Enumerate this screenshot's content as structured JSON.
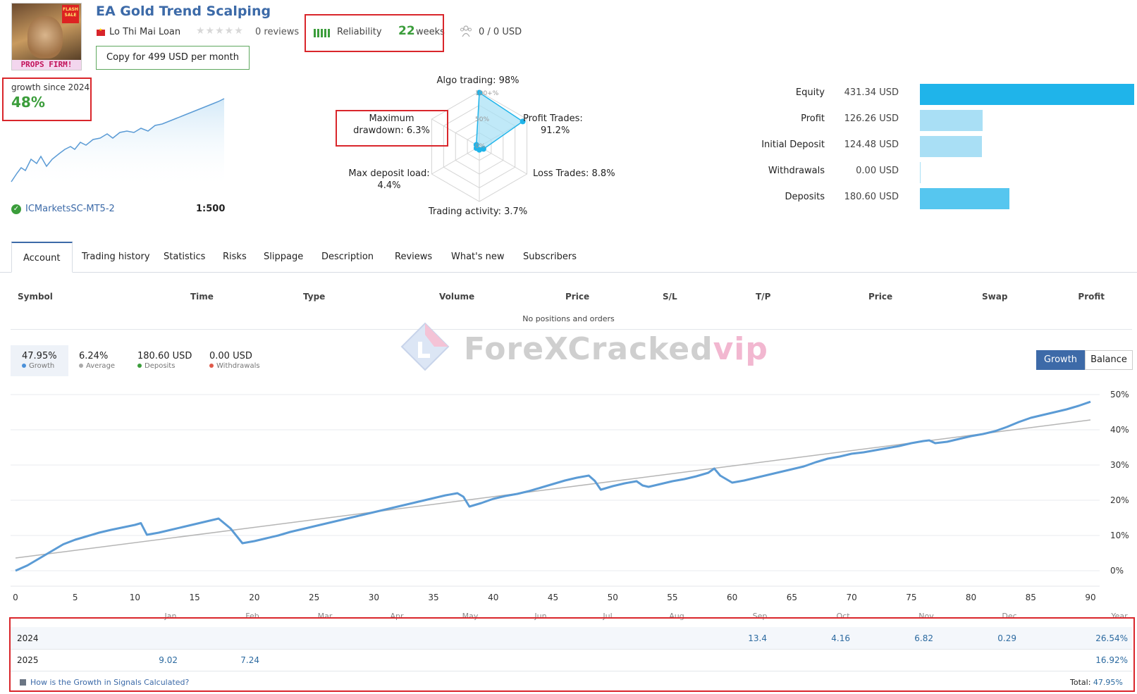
{
  "header": {
    "title": "EA Gold Trend Scalping",
    "author": "Lo Thi Mai Loan",
    "reviews": "0 reviews",
    "reliability_label": "Reliability",
    "weeks_number": "22",
    "weeks_label": "weeks",
    "subscribers": "0 / 0 USD",
    "copy_button": "Copy for 499 USD per month",
    "avatar_banner": "PROPS FIRM!",
    "avatar_badge": "FLASH SALE"
  },
  "growth_card": {
    "label": "growth since 2024",
    "value": "48%",
    "broker": "ICMarketsSC-MT5-2",
    "leverage": "1:500"
  },
  "radar": {
    "algo": "Algo trading: 98%",
    "profit_trades_1": "Profit Trades:",
    "profit_trades_2": "91.2%",
    "loss_trades": "Loss Trades: 8.8%",
    "activity": "Trading activity: 3.7%",
    "deposit_load_1": "Max deposit load:",
    "deposit_load_2": "4.4%",
    "drawdown_1": "Maximum",
    "drawdown_2": "drawdown: 6.3%",
    "ring_100": "100+%",
    "ring_50": "50%",
    "ring_0": "0%",
    "values": {
      "algo": 98,
      "profit": 91.2,
      "loss": 8.8,
      "activity": 3.7,
      "deposit_load": 4.4,
      "drawdown": 6.3
    }
  },
  "stats": [
    {
      "label": "Equity",
      "value": "431.34 USD",
      "fraction": 1.0,
      "color": "#1fb4ea"
    },
    {
      "label": "Profit",
      "value": "126.26 USD",
      "fraction": 0.293,
      "color": "#a9dff5"
    },
    {
      "label": "Initial Deposit",
      "value": "124.48 USD",
      "fraction": 0.289,
      "color": "#a9dff5"
    },
    {
      "label": "Withdrawals",
      "value": "0.00 USD",
      "fraction": 0.0,
      "color": "#a9dff5"
    },
    {
      "label": "Deposits",
      "value": "180.60 USD",
      "fraction": 0.419,
      "color": "#56c6ef"
    }
  ],
  "tabs": [
    "Account",
    "Trading history",
    "Statistics",
    "Risks",
    "Slippage",
    "Description",
    "Reviews",
    "What's new",
    "Subscribers"
  ],
  "positions": {
    "columns": [
      "Symbol",
      "Time",
      "Type",
      "Volume",
      "Price",
      "S/L",
      "T/P",
      "Price",
      "Swap",
      "Profit"
    ],
    "empty_text": "No positions and orders"
  },
  "summary": {
    "growth": {
      "value": "47.95%",
      "caption": "Growth",
      "color": "#4a90d9"
    },
    "average": {
      "value": "6.24%",
      "caption": "Average",
      "color": "#aaaaaa"
    },
    "deposits": {
      "value": "180.60 USD",
      "caption": "Deposits",
      "color": "#3b9d3b"
    },
    "withdrawals": {
      "value": "0.00 USD",
      "caption": "Withdrawals",
      "color": "#e05a4a"
    },
    "btn_growth": "Growth",
    "btn_balance": "Balance"
  },
  "watermark": {
    "main": "ForeXCracked",
    "suffix": "vip"
  },
  "chart_data": {
    "type": "line",
    "xlim": [
      0,
      90
    ],
    "ylim": [
      0,
      50
    ],
    "x_ticks": [
      0,
      5,
      10,
      15,
      20,
      25,
      30,
      35,
      40,
      45,
      50,
      55,
      60,
      65,
      70,
      75,
      80,
      85,
      90
    ],
    "y_ticks": [
      "50%",
      "40%",
      "30%",
      "20%",
      "10%",
      "0%"
    ],
    "y_tick_values": [
      50,
      40,
      30,
      20,
      10,
      0
    ],
    "grid": true,
    "series": [
      {
        "name": "Growth",
        "color": "#5b9bd5",
        "x": [
          0,
          1,
          2,
          3,
          4,
          5,
          6,
          7,
          8,
          9,
          10,
          10.5,
          11,
          12,
          13,
          14,
          15,
          16,
          17,
          18,
          19,
          20,
          21,
          22,
          23,
          24,
          25,
          26,
          27,
          28,
          29,
          30,
          31,
          32,
          33,
          34,
          35,
          36,
          37,
          37.5,
          38,
          39,
          40,
          41,
          42,
          43,
          44,
          45,
          46,
          47,
          48,
          48.5,
          49,
          50,
          51,
          52,
          52.5,
          53,
          54,
          55,
          56,
          57,
          58,
          58.5,
          59,
          60,
          61,
          62,
          63,
          64,
          65,
          66,
          67,
          68,
          69,
          70,
          71,
          72,
          73,
          74,
          75,
          76,
          76.5,
          77,
          78,
          79,
          80,
          81,
          82,
          83,
          84,
          85,
          86,
          87,
          88,
          89,
          90
        ],
        "y": [
          0,
          1.5,
          3.5,
          5.5,
          7.5,
          8.8,
          9.8,
          10.8,
          11.6,
          12.3,
          13.0,
          13.5,
          10.2,
          10.8,
          11.6,
          12.4,
          13.2,
          14.0,
          14.8,
          12.0,
          7.8,
          8.4,
          9.2,
          10.0,
          11.0,
          11.8,
          12.6,
          13.4,
          14.2,
          15.0,
          15.8,
          16.6,
          17.4,
          18.2,
          19.0,
          19.8,
          20.6,
          21.4,
          22.0,
          21.0,
          18.2,
          19.2,
          20.4,
          21.2,
          21.8,
          22.6,
          23.6,
          24.6,
          25.6,
          26.4,
          27.0,
          25.5,
          23.0,
          24.0,
          24.8,
          25.4,
          24.2,
          23.8,
          24.6,
          25.4,
          26.0,
          26.8,
          27.8,
          29.0,
          27.0,
          25.0,
          25.6,
          26.4,
          27.2,
          28.0,
          28.8,
          29.6,
          30.8,
          31.8,
          32.4,
          33.2,
          33.6,
          34.2,
          34.8,
          35.4,
          36.2,
          36.8,
          37.0,
          36.2,
          36.6,
          37.4,
          38.2,
          38.8,
          39.6,
          40.8,
          42.2,
          43.4,
          44.2,
          45.0,
          45.8,
          46.8,
          47.95
        ]
      },
      {
        "name": "Average",
        "color": "#b5b5b5",
        "x": [
          0,
          90
        ],
        "y": [
          3.6,
          42.8
        ]
      }
    ]
  },
  "growth_table": {
    "months": [
      "Jan",
      "Feb",
      "Mar",
      "Apr",
      "May",
      "Jun",
      "Jul",
      "Aug",
      "Sep",
      "Oct",
      "Nov",
      "Dec",
      "Year"
    ],
    "rows": [
      {
        "year": "2024",
        "values": [
          "",
          "",
          "",
          "",
          "",
          "",
          "",
          "",
          "13.4",
          "4.16",
          "6.82",
          "0.29"
        ],
        "total": "26.54%"
      },
      {
        "year": "2025",
        "values": [
          "9.02",
          "7.24",
          "",
          "",
          "",
          "",
          "",
          "",
          "",
          "",
          "",
          ""
        ],
        "total": "16.92%"
      }
    ],
    "footer_link": "How is the Growth in Signals Calculated?",
    "total_label": "Total:",
    "total_value": "47.95%"
  }
}
